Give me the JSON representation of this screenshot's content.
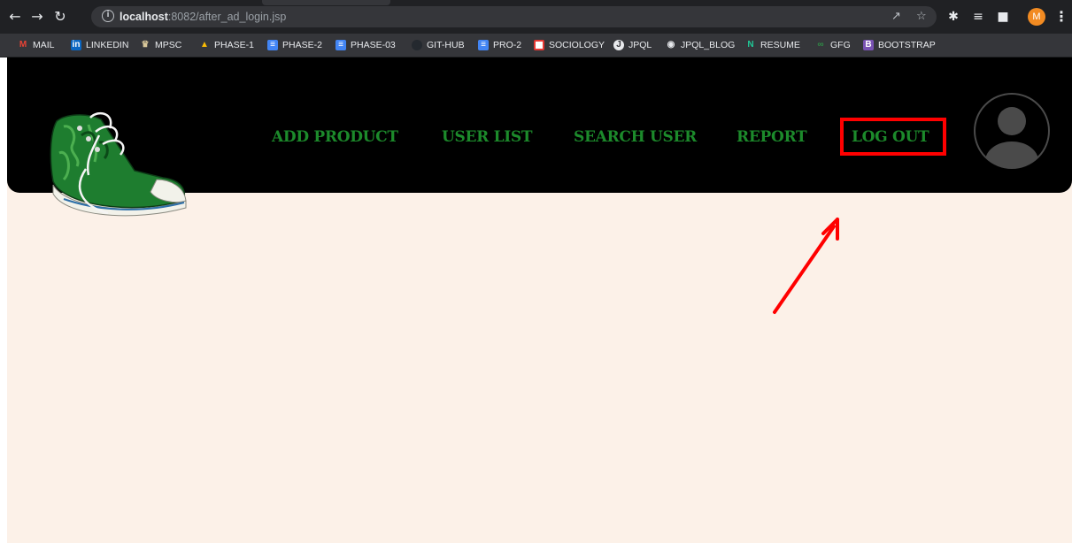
{
  "browser": {
    "url_host": "localhost",
    "url_rest": ":8082/after_ad_login.jsp",
    "profile_initial": "M"
  },
  "bookmarks": [
    {
      "label": "MAIL",
      "icon": "gmail-icon"
    },
    {
      "label": "LINKEDIN",
      "icon": "linkedin-icon"
    },
    {
      "label": "MPSC",
      "icon": "emblem-icon"
    },
    {
      "label": "PHASE-1",
      "icon": "drive-icon"
    },
    {
      "label": "PHASE-2",
      "icon": "docs-icon"
    },
    {
      "label": "PHASE-03",
      "icon": "docs-icon"
    },
    {
      "label": "GIT-HUB",
      "icon": "github-icon"
    },
    {
      "label": "PRO-2",
      "icon": "docs-icon"
    },
    {
      "label": "SOCIOLOGY",
      "icon": "red-square-icon"
    },
    {
      "label": "JPQL",
      "icon": "jpql-icon"
    },
    {
      "label": "JPQL_BLOG",
      "icon": "globe-icon"
    },
    {
      "label": "RESUME",
      "icon": "n-icon"
    },
    {
      "label": "GFG",
      "icon": "gfg-icon"
    },
    {
      "label": "BOOTSTRAP",
      "icon": "bootstrap-icon"
    }
  ],
  "nav": {
    "add_product": "ADD PRODUCT",
    "user_list": "USER LIST",
    "search_user": "SEARCH USER",
    "report": "REPORT",
    "log_out": "LOG OUT"
  },
  "colors": {
    "header_bg": "#000000",
    "nav_text": "#1c8a2b",
    "page_bg": "#fcf1e8",
    "highlight": "#ff0000"
  }
}
